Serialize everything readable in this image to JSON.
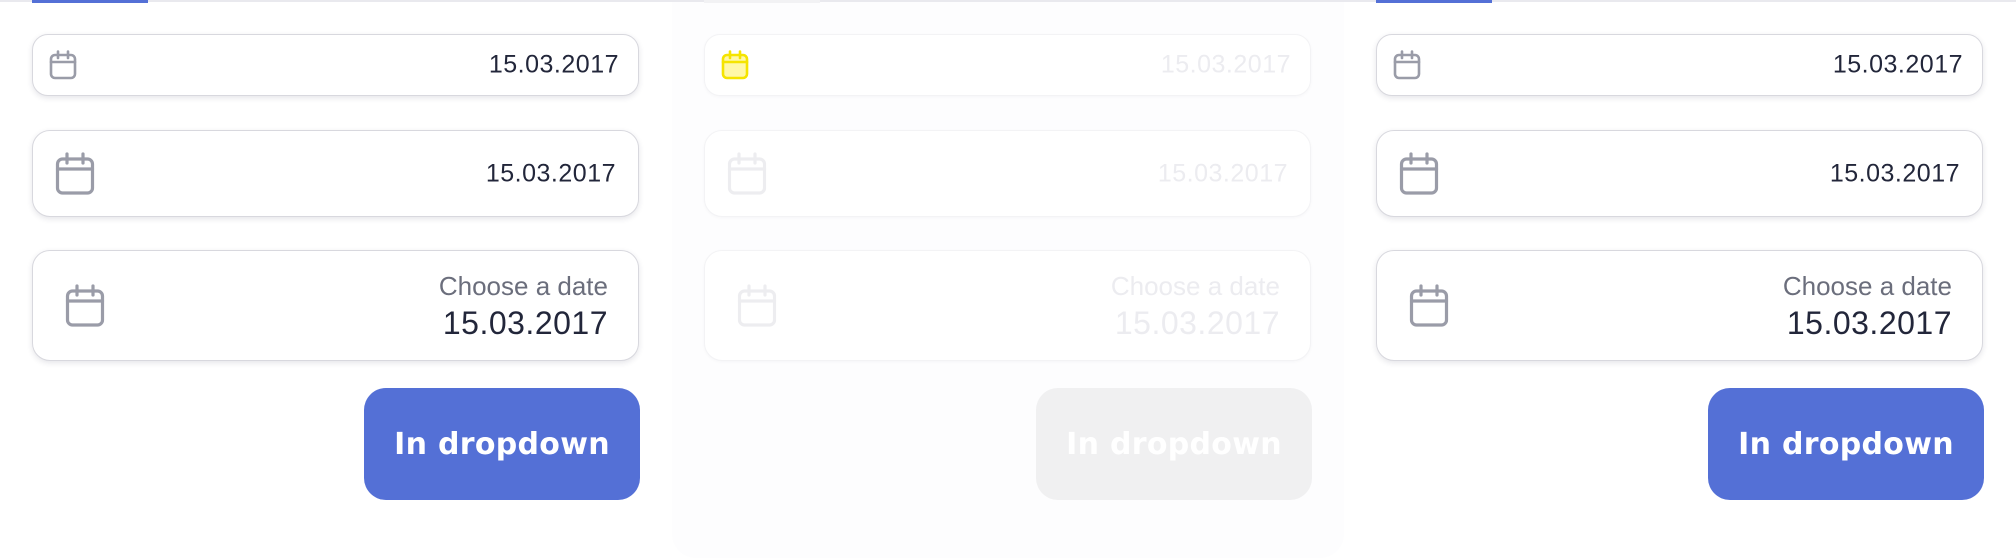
{
  "colors": {
    "accent": "#5470d6",
    "text": "#22263a",
    "label": "#6b6e7c",
    "icon": "#9a9ca8",
    "border": "#d8d8de",
    "disabled_button": "#f0f0f1",
    "focus_highlight": "#f5e400"
  },
  "panels": [
    {
      "state": "default",
      "small_field": {
        "icon": "calendar-icon",
        "value": "15.03.2017"
      },
      "medium_field": {
        "icon": "calendar-icon",
        "value": "15.03.2017"
      },
      "large_field": {
        "icon": "calendar-icon",
        "label": "Choose a date",
        "value": "15.03.2017"
      },
      "button": {
        "label": "In dropdown"
      }
    },
    {
      "state": "disabled",
      "small_field": {
        "icon": "calendar-icon",
        "value": "15.03.2017"
      },
      "medium_field": {
        "icon": "calendar-icon",
        "value": "15.03.2017"
      },
      "large_field": {
        "icon": "calendar-icon",
        "label": "Choose a date",
        "value": "15.03.2017"
      },
      "button": {
        "label": "In dropdown"
      }
    },
    {
      "state": "default",
      "small_field": {
        "icon": "calendar-icon",
        "value": "15.03.2017"
      },
      "medium_field": {
        "icon": "calendar-icon",
        "value": "15.03.2017"
      },
      "large_field": {
        "icon": "calendar-icon",
        "label": "Choose a date",
        "value": "15.03.2017"
      },
      "button": {
        "label": "In dropdown"
      }
    }
  ]
}
